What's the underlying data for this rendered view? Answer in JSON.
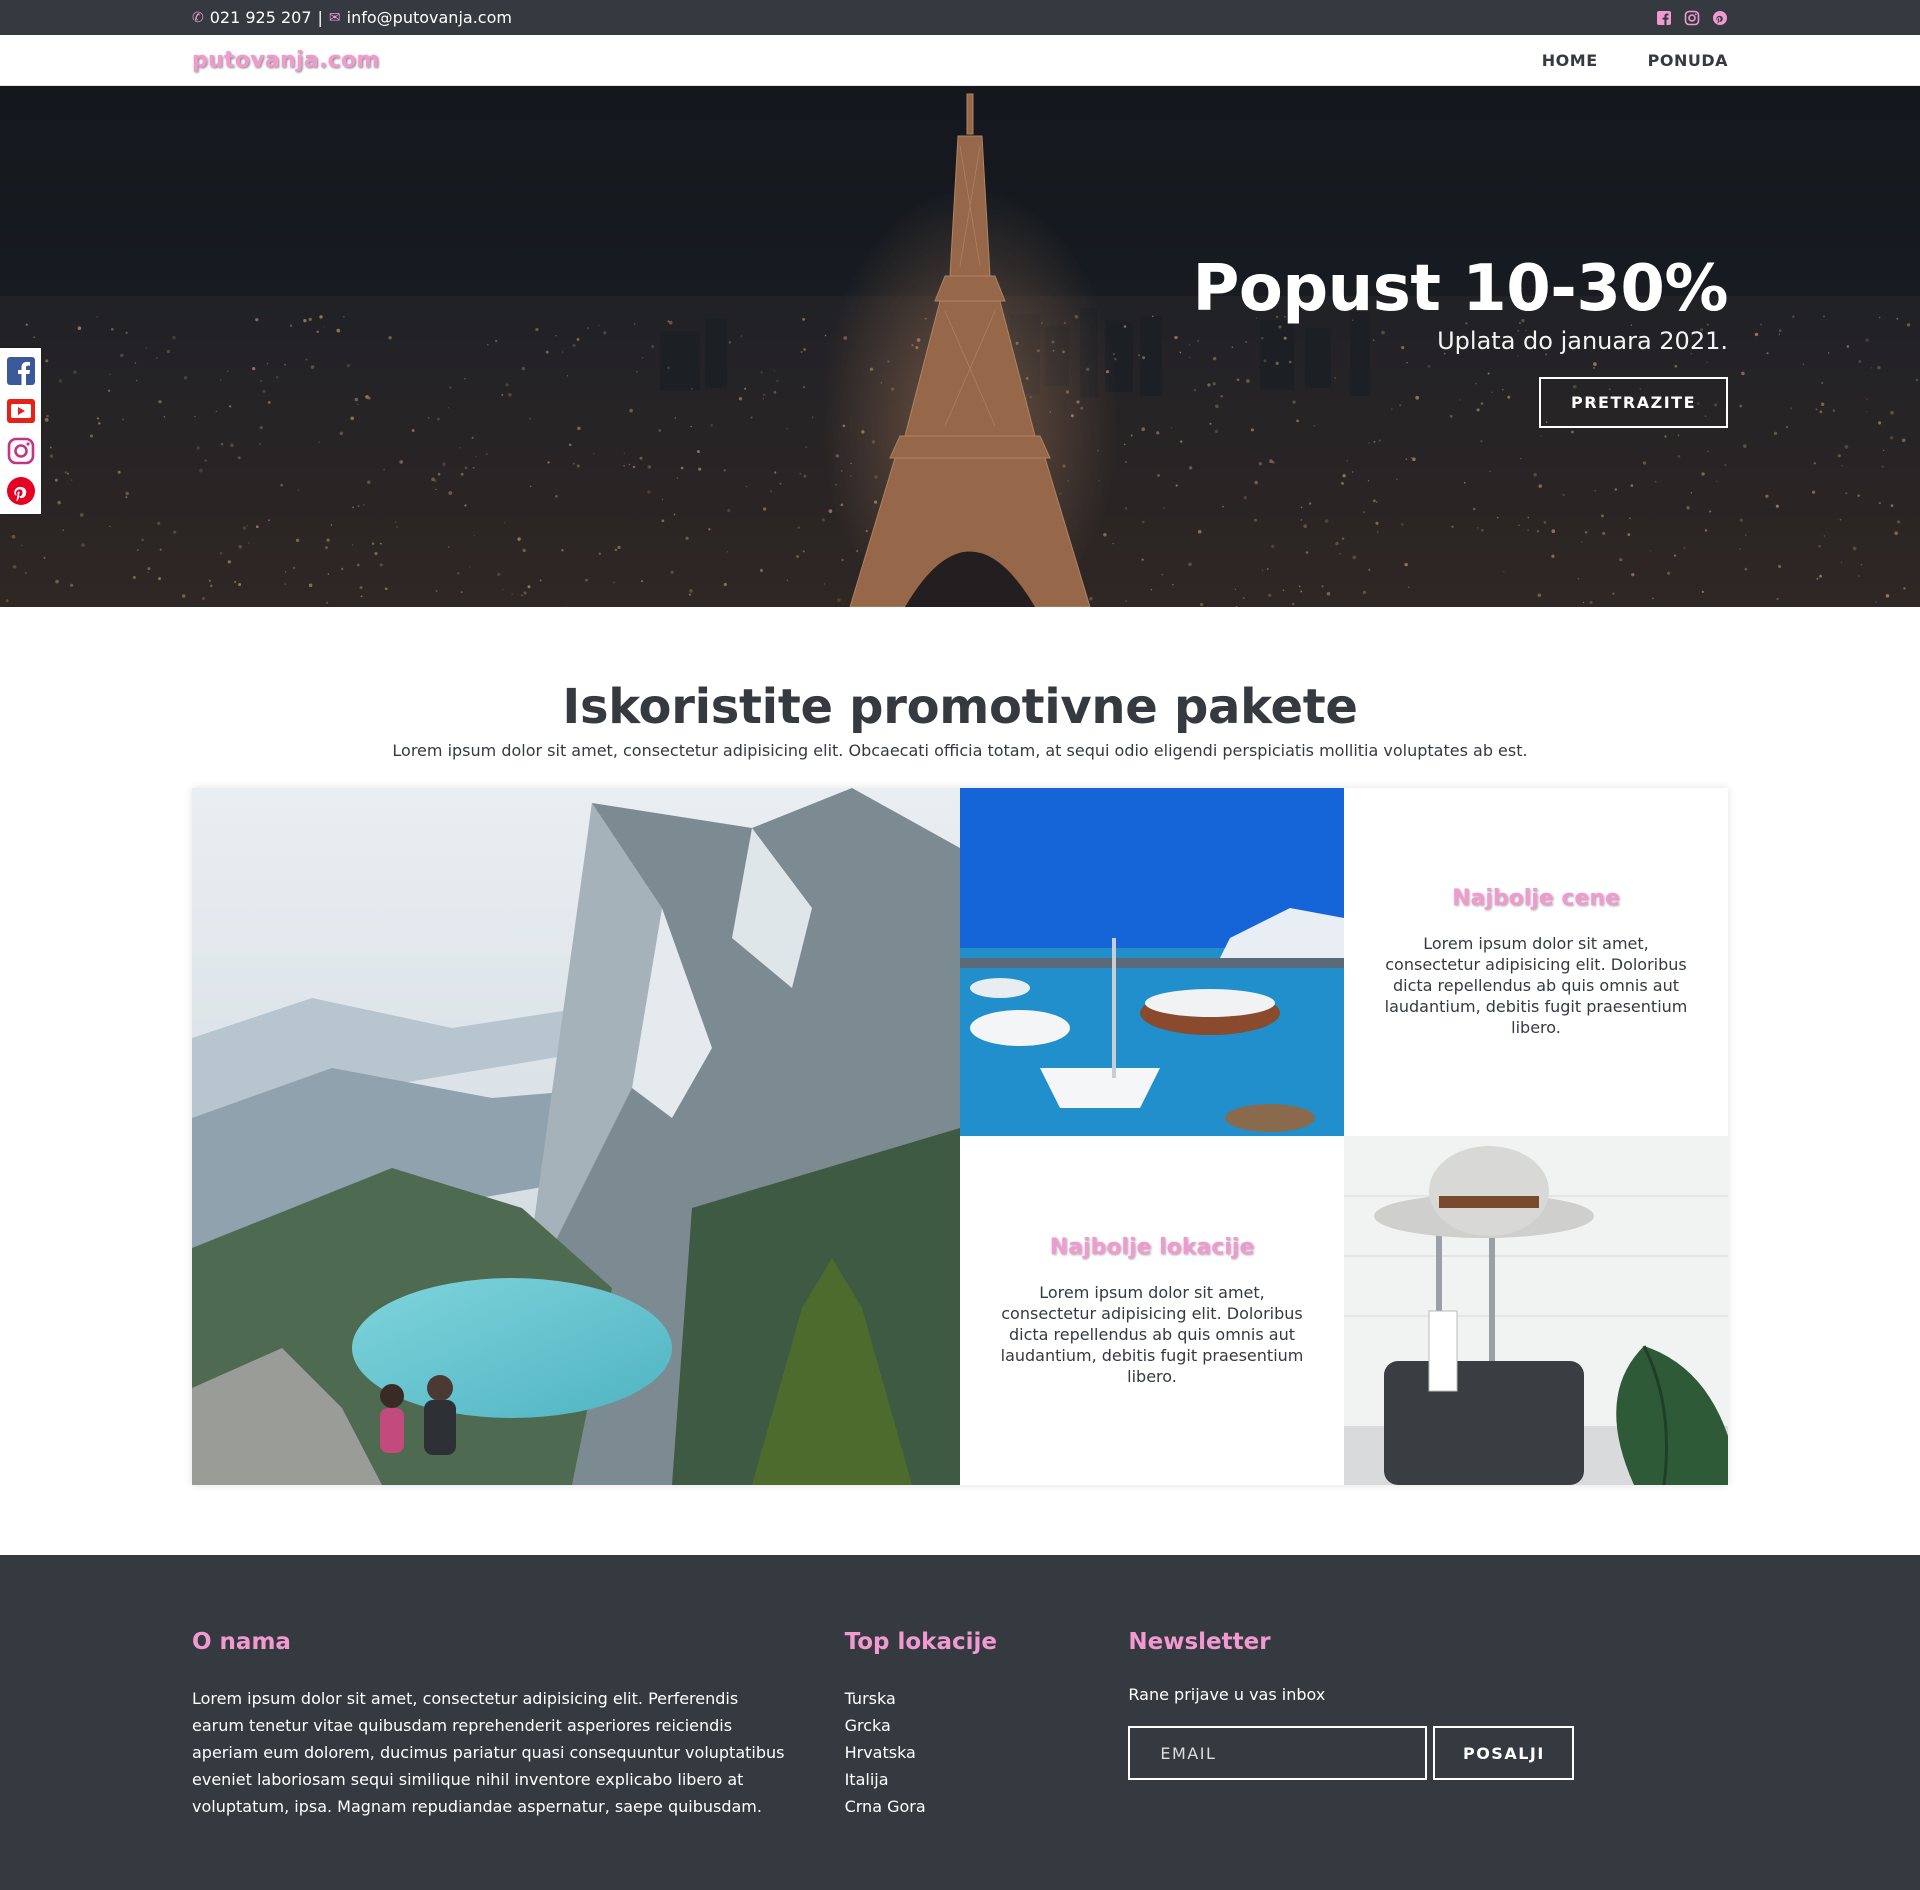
{
  "topbar": {
    "phone": "021 925 207",
    "separator": "|",
    "email": "info@putovanja.com",
    "social_icons": [
      "facebook-square-icon",
      "instagram-icon",
      "pinterest-icon"
    ]
  },
  "nav": {
    "logo": "putovanja.com",
    "links": [
      "HOME",
      "PONUDA"
    ]
  },
  "hero": {
    "title": "Popust 10-30%",
    "subtitle": "Uplata do januara 2021.",
    "button": "PRETRAZITE"
  },
  "side_rail": {
    "icons": [
      "facebook-icon",
      "youtube-icon",
      "instagram-icon",
      "pinterest-icon"
    ]
  },
  "promo": {
    "title": "Iskoristite promotivne pakete",
    "subtitle": "Lorem ipsum dolor sit amet, consectetur adipisicing elit. Obcaecati officia totam, at sequi odio eligendi perspiciatis mollitia voluptates ab est.",
    "cards": [
      {
        "title": "Najbolje cene",
        "body": "Lorem ipsum dolor sit amet, consectetur adipisicing elit. Doloribus dicta repellendus ab quis omnis aut laudantium, debitis fugit praesentium libero."
      },
      {
        "title": "Najbolje lokacije",
        "body": "Lorem ipsum dolor sit amet, consectetur adipisicing elit. Doloribus dicta repellendus ab quis omnis aut laudantium, debitis fugit praesentium libero."
      }
    ]
  },
  "footer": {
    "about_title": "O nama",
    "about_text": "Lorem ipsum dolor sit amet, consectetur adipisicing elit. Perferendis earum tenetur vitae quibusdam reprehenderit asperiores reiciendis aperiam eum dolorem, ducimus pariatur quasi consequuntur voluptatibus eveniet laboriosam sequi similique nihil inventore explicabo libero at voluptatum, ipsa. Magnam repudiandae aspernatur, saepe quibusdam.",
    "top_title": "Top lokacije",
    "top_items": [
      "Turska",
      "Grcka",
      "Hrvatska",
      "Italija",
      "Crna Gora"
    ],
    "news_title": "Newsletter",
    "news_text": "Rane prijave u vas inbox",
    "email_placeholder": "EMAIL",
    "send_button": "POSALJI"
  },
  "colors": {
    "accent": "#f29ad0",
    "dark": "#343a40"
  }
}
